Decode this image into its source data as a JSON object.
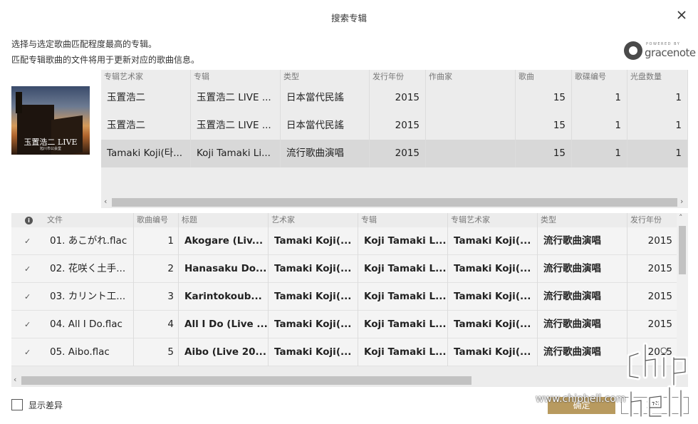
{
  "dialog": {
    "title": "搜索专辑",
    "instruction_line1": "选择与选定歌曲匹配程度最高的专辑。",
    "instruction_line2": "匹配专辑歌曲的文件将用于更新对应的歌曲信息。",
    "gracenote_powered": "POWERED BY",
    "gracenote_brand": "gracenote"
  },
  "cover": {
    "title": "玉置浩二 LIVE",
    "subtitle": "旭川市公会堂"
  },
  "albums": {
    "headers": [
      "专辑艺术家",
      "专辑",
      "类型",
      "发行年份",
      "作曲家",
      "歌曲",
      "歌碟编号",
      "光盘数量"
    ],
    "rows": [
      {
        "artist": "玉置浩二",
        "album": "玉置浩二 LIVE ...",
        "genre": "日本當代民謠",
        "year": "2015",
        "composer": "",
        "tracks": "15",
        "disc": "1",
        "discs": "1"
      },
      {
        "artist": "玉置浩二",
        "album": "玉置浩二 LIVE ...",
        "genre": "日本當代民謠",
        "year": "2015",
        "composer": "",
        "tracks": "15",
        "disc": "1",
        "discs": "1"
      },
      {
        "artist": "Tamaki Koji(타...",
        "album": "Koji Tamaki Li...",
        "genre": "流行歌曲演唱",
        "year": "2015",
        "composer": "",
        "tracks": "15",
        "disc": "1",
        "discs": "1"
      }
    ]
  },
  "songs": {
    "headers": [
      "文件",
      "歌曲编号",
      "标题",
      "艺术家",
      "专辑",
      "专辑艺术家",
      "类型",
      "发行年份"
    ],
    "rows": [
      {
        "file": "01. あこがれ.flac",
        "no": "1",
        "title": "Akogare (Liv...",
        "artist": "Tamaki Koji(...",
        "album": "Koji Tamaki L...",
        "album_artist": "Tamaki Koji(...",
        "genre": "流行歌曲演唱",
        "year": "2015"
      },
      {
        "file": "02. 花咲く土手...",
        "no": "2",
        "title": "Hanasaku Do...",
        "artist": "Tamaki Koji(...",
        "album": "Koji Tamaki L...",
        "album_artist": "Tamaki Koji(...",
        "genre": "流行歌曲演唱",
        "year": "2015"
      },
      {
        "file": "03. カリント工...",
        "no": "3",
        "title": "Karintokoub...",
        "artist": "Tamaki Koji(...",
        "album": "Koji Tamaki L...",
        "album_artist": "Tamaki Koji(...",
        "genre": "流行歌曲演唱",
        "year": "2015"
      },
      {
        "file": "04. All I Do.flac",
        "no": "4",
        "title": "All I Do (Live ...",
        "artist": "Tamaki Koji(...",
        "album": "Koji Tamaki L...",
        "album_artist": "Tamaki Koji(...",
        "genre": "流行歌曲演唱",
        "year": "2015"
      },
      {
        "file": "05. Aibo.flac",
        "no": "5",
        "title": "Aibo (Live 20...",
        "artist": "Tamaki Koji(...",
        "album": "Koji Tamaki L...",
        "album_artist": "Tamaki Koji(...",
        "genre": "流行歌曲演唱",
        "year": "2015"
      }
    ]
  },
  "footer": {
    "show_diff_label": "显示差异",
    "ok_label": "确定",
    "cancel_label": "取消",
    "watermark": "www.chiphell.com"
  },
  "colors": {
    "accent": "#b89a5f",
    "table_bg": "#ececec",
    "selected_row": "#d8d8d8"
  },
  "icons": {
    "close": "close-icon",
    "info": "info-icon",
    "check": "checkmark-icon"
  }
}
